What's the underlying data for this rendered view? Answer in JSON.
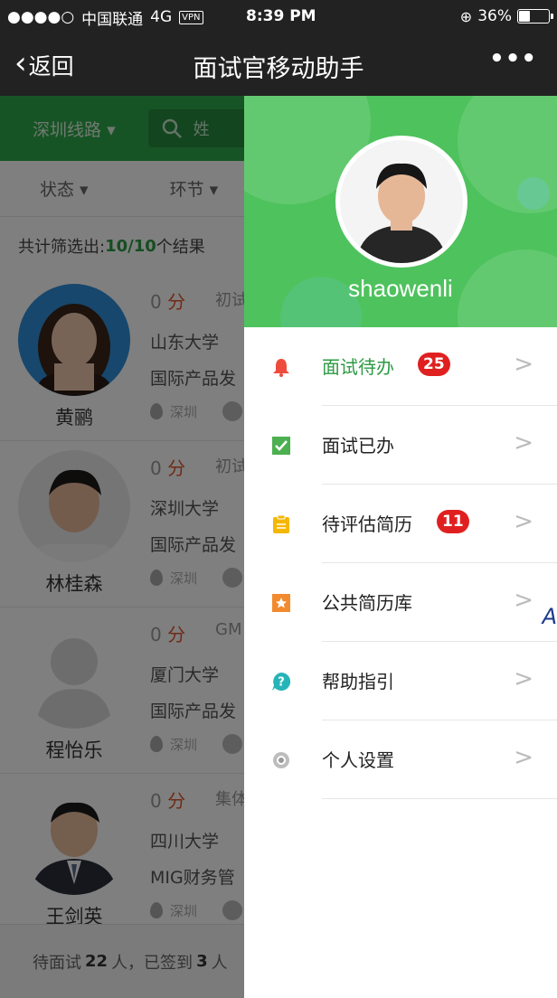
{
  "status_bar": {
    "signal": "●●●●○",
    "carrier": "中国联通",
    "network": "4G",
    "vpn": "VPN",
    "time": "8:39 PM",
    "battery": "36%",
    "battery_level": 0.36
  },
  "nav": {
    "back_label": "返回",
    "title": "面试官移动助手",
    "more": "•••"
  },
  "list_page": {
    "city_filter": "深圳线路",
    "search_placeholder": "姓",
    "filters": [
      "状态",
      "环节"
    ],
    "result_prefix": "共计筛选出:",
    "result_count": "10/10",
    "result_suffix": "个结果",
    "candidates": [
      {
        "name": "黄鹂",
        "score": "0",
        "score_unit": "分",
        "stage": "初试",
        "school": "山东大学",
        "department": "国际产品发",
        "location": "深圳"
      },
      {
        "name": "林桂森",
        "score": "0",
        "score_unit": "分",
        "stage": "初试",
        "school": "深圳大学",
        "department": "国际产品发",
        "location": "深圳"
      },
      {
        "name": "程怡乐",
        "score": "0",
        "score_unit": "分",
        "stage": "GM",
        "school": "厦门大学",
        "department": "国际产品发",
        "location": "深圳"
      },
      {
        "name": "王剑英",
        "score": "0",
        "score_unit": "分",
        "stage": "集体",
        "school": "四川大学",
        "department": "MIG财务管",
        "location": "深圳"
      }
    ],
    "footer": {
      "prefix": "待面试",
      "pending": "22",
      "mid": "人，已签到",
      "signed": "3",
      "suffix": "人"
    }
  },
  "drawer": {
    "username": "shaowenli",
    "menu": [
      {
        "label": "面试待办",
        "badge": "25",
        "icon": "bell-icon",
        "color": "#ef4b3c"
      },
      {
        "label": "面试已办",
        "badge": "",
        "icon": "checkbox-checked-icon",
        "color": "#4caf50"
      },
      {
        "label": "待评估简历",
        "badge": "11",
        "icon": "clipboard-icon",
        "color": "#f5b700"
      },
      {
        "label": "公共简历库",
        "badge": "",
        "icon": "star-box-icon",
        "color": "#f28a2e"
      },
      {
        "label": "帮助指引",
        "badge": "",
        "icon": "help-icon",
        "color": "#27b4b8"
      },
      {
        "label": "个人设置",
        "badge": "",
        "icon": "settings-icon",
        "color": "#999999"
      }
    ],
    "arrow": ">"
  },
  "edge_char": "A"
}
